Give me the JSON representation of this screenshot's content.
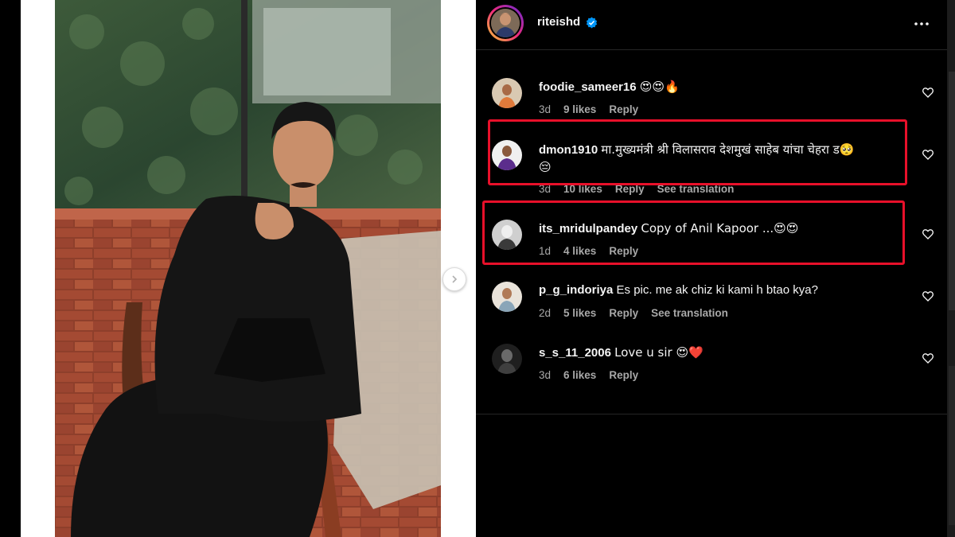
{
  "post": {
    "username": "riteishd",
    "verified": true,
    "more_icon": "more-horizontal-icon"
  },
  "comments": [
    {
      "user": "foodie_sameer16",
      "text": "😍😍🔥",
      "time": "3d",
      "likes": "9 likes",
      "reply": "Reply",
      "translation": ""
    },
    {
      "user": "dmon1910",
      "text": "मा.मुख्यमंत्री श्री विलासराव देशमुखं साहेब यांचा चेहरा ड🥺",
      "text2": "😔",
      "time": "3d",
      "likes": "10 likes",
      "reply": "Reply",
      "translation": "See translation"
    },
    {
      "user": "its_mridulpandey",
      "text": "Copy of Anil Kapoor ...😍😍",
      "time": "1d",
      "likes": "4 likes",
      "reply": "Reply",
      "translation": ""
    },
    {
      "user": "p_g_indoriya",
      "text": "Es pic. me ak chiz ki kami h btao kya?",
      "time": "2d",
      "likes": "5 likes",
      "reply": "Reply",
      "translation": "See translation"
    },
    {
      "user": "s_s_11_2006",
      "text": "Love u sir 😍❤️",
      "time": "3d",
      "likes": "6 likes",
      "reply": "Reply",
      "translation": ""
    }
  ],
  "colors": {
    "highlight": "#e8102a",
    "verified": "#0095f6",
    "background": "#000000",
    "meta_text": "#a8a8a8"
  }
}
